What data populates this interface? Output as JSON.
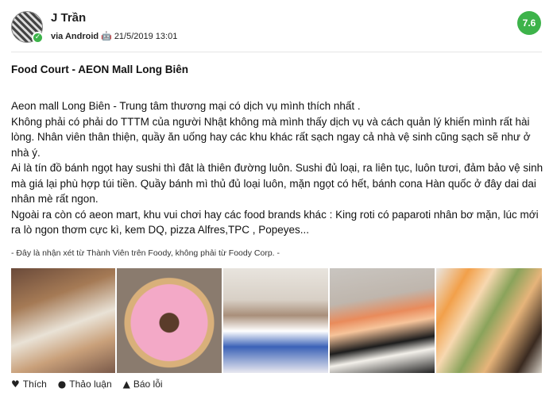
{
  "review": {
    "user": {
      "name": "J Trần",
      "via": "via Android",
      "datetime": "21/5/2019 13:01",
      "verified_icon": "check-icon",
      "platform_icon": "android-icon"
    },
    "score": "7.6",
    "score_color": "#3db34a",
    "title": "Food Court - AEON Mall Long Biên",
    "body": [
      "Aeon mall Long Biên - Trung tâm thương mại có dịch vụ mình thích nhất .",
      "Không phải có phải do TTTM của người Nhật không mà mình thấy dịch vụ và cách quản lý khiến mình rất hài lòng. Nhân viên thân thiện, quầy ăn uống hay các khu khác rất sạch ngay cả nhà vệ sinh cũng sạch sẽ như ở nhà ý.",
      "Ai là tín đồ bánh ngọt hay sushi thì đât là thiên đường luôn. Sushi đủ loại, ra liên tục, luôn tươi, đảm bảo vệ sinh mà giá lại phù hợp túi tiền. Quầy bánh mì thủ đủ loại luôn, mặn ngọt có hết, bánh cona Hàn quốc ở đây dai dai nhân mè rất ngon.",
      "Ngoài ra còn có aeon mart, khu vui chơi hay các food brands khác : King roti có paparoti nhân bơ mặn, lúc mới ra lò ngon thơm cực kì, kem DQ, pizza Alfres,TPC , Popeyes..."
    ],
    "disclaimer": "- Đây là nhận xét từ Thành Viên trên Foody, không phải từ Foody Corp. -",
    "photos": [
      "sushi-tray",
      "pink-donut",
      "ice-cream-cups",
      "sushi-box",
      "bakery-pastries"
    ],
    "actions": {
      "like": {
        "label": "Thích",
        "icon": "thumbs-up-icon"
      },
      "comment": {
        "label": "Thảo luận",
        "icon": "speech-bubble-icon"
      },
      "report": {
        "label": "Báo lỗi",
        "icon": "warning-icon"
      }
    }
  }
}
